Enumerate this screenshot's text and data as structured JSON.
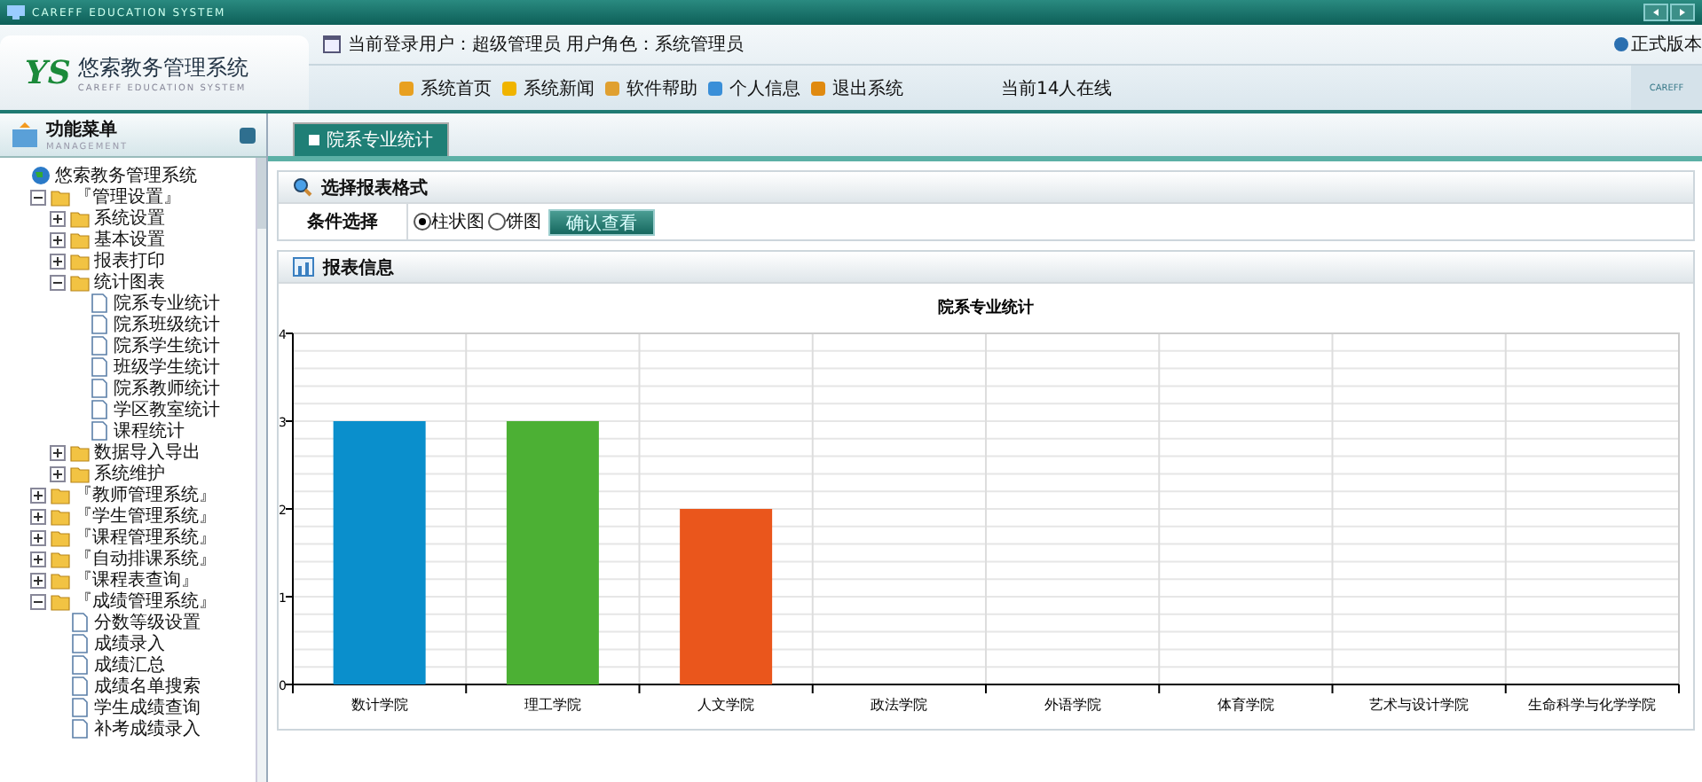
{
  "top_strip": {
    "brand": "CAREFF EDUCATION SYSTEM"
  },
  "header": {
    "logo_mark": "YS",
    "title": "悠索教务管理系统",
    "subtitle": "CAREFF EDUCATION SYSTEM",
    "user_info": "当前登录用户：超级管理员 用户角色：系统管理员",
    "edition": "正式版本",
    "online": "当前14人在线",
    "corner_brand": "CAREFF",
    "nav": [
      {
        "label": "系统首页",
        "kind": "pen"
      },
      {
        "label": "系统新闻",
        "kind": "globe"
      },
      {
        "label": "软件帮助",
        "kind": "gift"
      },
      {
        "label": "个人信息",
        "kind": "cubes"
      },
      {
        "label": "退出系统",
        "kind": "box"
      }
    ]
  },
  "sidebar": {
    "title": "功能菜单",
    "subtitle": "MANAGEMENT",
    "tree": [
      {
        "label": "悠索教务管理系统",
        "kind": "root",
        "children": [
          {
            "label": "『管理设置』",
            "kind": "folder",
            "expanded": true,
            "children": [
              {
                "label": "系统设置",
                "kind": "folder",
                "expanded": false
              },
              {
                "label": "基本设置",
                "kind": "folder",
                "expanded": false
              },
              {
                "label": "报表打印",
                "kind": "folder",
                "expanded": false
              },
              {
                "label": "统计图表",
                "kind": "folder",
                "expanded": true,
                "children": [
                  {
                    "label": "院系专业统计",
                    "kind": "leaf"
                  },
                  {
                    "label": "院系班级统计",
                    "kind": "leaf"
                  },
                  {
                    "label": "院系学生统计",
                    "kind": "leaf"
                  },
                  {
                    "label": "班级学生统计",
                    "kind": "leaf"
                  },
                  {
                    "label": "院系教师统计",
                    "kind": "leaf"
                  },
                  {
                    "label": "学区教室统计",
                    "kind": "leaf"
                  },
                  {
                    "label": "课程统计",
                    "kind": "leaf"
                  }
                ]
              },
              {
                "label": "数据导入导出",
                "kind": "folder",
                "expanded": false
              },
              {
                "label": "系统维护",
                "kind": "folder",
                "expanded": false
              }
            ]
          },
          {
            "label": "『教师管理系统』",
            "kind": "folder",
            "expanded": false
          },
          {
            "label": "『学生管理系统』",
            "kind": "folder",
            "expanded": false
          },
          {
            "label": "『课程管理系统』",
            "kind": "folder",
            "expanded": false
          },
          {
            "label": "『自动排课系统』",
            "kind": "folder",
            "expanded": false
          },
          {
            "label": "『课程表查询』",
            "kind": "folder",
            "expanded": false
          },
          {
            "label": "『成绩管理系统』",
            "kind": "folder",
            "expanded": true,
            "children": [
              {
                "label": "分数等级设置",
                "kind": "leaf"
              },
              {
                "label": "成绩录入",
                "kind": "leaf"
              },
              {
                "label": "成绩汇总",
                "kind": "leaf"
              },
              {
                "label": "成绩名单搜索",
                "kind": "leaf"
              },
              {
                "label": "学生成绩查询",
                "kind": "leaf"
              },
              {
                "label": "补考成绩录入",
                "kind": "leaf"
              }
            ]
          }
        ]
      }
    ]
  },
  "tabs": [
    {
      "label": "院系专业统计",
      "selected": true
    }
  ],
  "format_panel": {
    "title": "选择报表格式",
    "condition_label": "条件选择",
    "options": [
      {
        "label": "柱状图",
        "selected": true
      },
      {
        "label": "饼图",
        "selected": false
      }
    ],
    "button": "确认查看"
  },
  "report_panel": {
    "title": "报表信息",
    "chart_data": {
      "type": "bar",
      "title": "院系专业统计",
      "categories": [
        "数计学院",
        "理工学院",
        "人文学院",
        "政法学院",
        "外语学院",
        "体育学院",
        "艺术与设计学院",
        "生命科学与化学学院"
      ],
      "values": [
        3,
        3,
        2,
        0,
        0,
        0,
        0,
        0
      ],
      "colors": [
        "#0a8fcc",
        "#4cb034",
        "#ea561c",
        null,
        null,
        null,
        null,
        null
      ],
      "grid": true,
      "ylim": [
        0,
        4
      ],
      "yticks": [
        0,
        1,
        2,
        3,
        4
      ]
    }
  }
}
